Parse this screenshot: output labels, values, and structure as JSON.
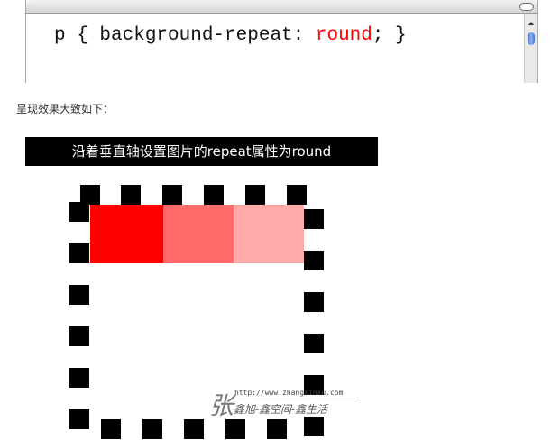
{
  "code": {
    "prefix": "p { background-repeat: ",
    "value": "round",
    "suffix": "; }"
  },
  "caption": "呈现效果大致如下：",
  "demo": {
    "header": "沿着垂直轴设置图片的repeat属性为round",
    "fill_colors": [
      "#ff0000",
      "#ff6b6b",
      "#ffa9a9"
    ]
  },
  "watermark": {
    "char": "张",
    "url": "http://www.zhangxinxu.com",
    "name": "鑫旭-鑫空间-鑫生活"
  }
}
